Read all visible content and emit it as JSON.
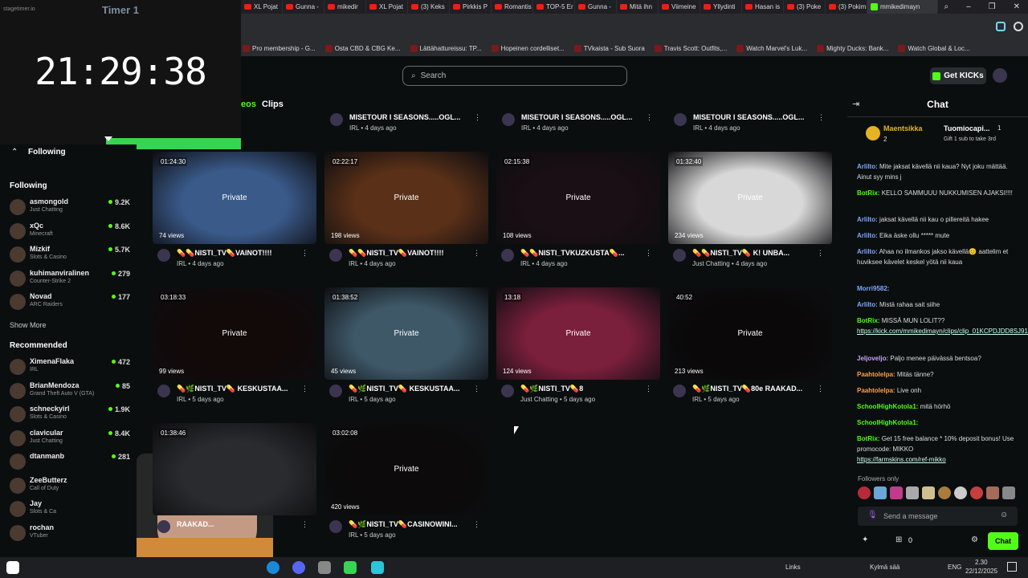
{
  "browser": {
    "tabs": [
      {
        "label": "XL Pojat",
        "icon": "youtube-icon"
      },
      {
        "label": "Gunna -",
        "icon": "youtube-icon"
      },
      {
        "label": "mikedir",
        "icon": "youtube-icon"
      },
      {
        "label": "XL Pojat",
        "icon": "youtube-icon"
      },
      {
        "label": "(3) Keks",
        "icon": "youtube-icon"
      },
      {
        "label": "Pirkkis P",
        "icon": "youtube-icon"
      },
      {
        "label": "Romantis",
        "icon": "youtube-icon"
      },
      {
        "label": "TOP-5 Er",
        "icon": "youtube-icon"
      },
      {
        "label": "Gunna -",
        "icon": "youtube-icon"
      },
      {
        "label": "Mitä ihn",
        "icon": "youtube-icon"
      },
      {
        "label": "Viimeine",
        "icon": "youtube-icon"
      },
      {
        "label": "Yllydinti",
        "icon": "youtube-icon"
      },
      {
        "label": "Hasan is",
        "icon": "youtube-icon"
      },
      {
        "label": "(3) Poke",
        "icon": "youtube-icon"
      },
      {
        "label": "(3) Pokim",
        "icon": "youtube-icon"
      },
      {
        "label": "mmikedimayn",
        "icon": "kick-icon"
      }
    ],
    "bookmarks": [
      "Pro membership - G...",
      "Osta CBD & CBG Ke...",
      "Lättähattureissu: TP...",
      "Hopeinen cordelliset...",
      "TVkaista - Sub Suora",
      "Travis Scott: Outfits,...",
      "Watch Marvel's Luk...",
      "Mighty Ducks: Bank...",
      "Watch Global & Loc..."
    ]
  },
  "timer": {
    "app": "stagetimer.io",
    "name": "Timer 1",
    "time": "21:29:38",
    "progress": 0.56
  },
  "header": {
    "search_placeholder": "Search",
    "get_kicks": "Get KICKs"
  },
  "tabs": {
    "videos": "eos",
    "clips": "Clips"
  },
  "sidebar": {
    "following_label": "Following",
    "following_section": "Following",
    "following": [
      {
        "name": "asmongold",
        "game": "Just Chatting",
        "viewers": "9.2K"
      },
      {
        "name": "xQc",
        "game": "Minecraft",
        "viewers": "8.6K"
      },
      {
        "name": "Mizkif",
        "game": "Slots & Casino",
        "viewers": "5.7K"
      },
      {
        "name": "kuhimanviralinen",
        "game": "Counter-Strike 2",
        "viewers": "279"
      },
      {
        "name": "Novad",
        "game": "ARC Raiders",
        "viewers": "177"
      }
    ],
    "show_more": "Show More",
    "recommended_section": "Recommended",
    "recommended": [
      {
        "name": "XimenaFlaka",
        "game": "IRL",
        "viewers": "472"
      },
      {
        "name": "BrianMendoza",
        "game": "Grand Theft Auto V (GTA)",
        "viewers": "85"
      },
      {
        "name": "schneckyirl",
        "game": "Slots & Casino",
        "viewers": "1.9K"
      },
      {
        "name": "clavicular",
        "game": "Just Chatting",
        "viewers": "8.4K"
      },
      {
        "name": "dtanmanb",
        "game": "",
        "viewers": "281"
      },
      {
        "name": "ZeeButterz",
        "game": "Call of Duty",
        "viewers": ""
      },
      {
        "name": "Jay",
        "game": "Slots & Ca",
        "viewers": ""
      },
      {
        "name": "rochan",
        "game": "VTuber",
        "viewers": ""
      }
    ]
  },
  "top_row": [
    {
      "title": "MISETOUR I SEASONS.....OGL...",
      "meta": "IRL • 4 days ago"
    },
    {
      "title": "MISETOUR I SEASONS.....OGL...",
      "meta": "IRL • 4 days ago"
    },
    {
      "title": "MISETOUR I SEASONS.....OGL...",
      "meta": "IRL • 4 days ago"
    }
  ],
  "videos": [
    {
      "duration": "01:24:30",
      "status": "Private",
      "views": "74 views",
      "title": "💊💊NISTI_TV💊VAINOT!!!!",
      "meta": "IRL • 4 days ago",
      "bg": "#3a5a8a"
    },
    {
      "duration": "02:22:17",
      "status": "Private",
      "views": "198 views",
      "title": "💊💊NISTI_TV💊VAINOT!!!!",
      "meta": "IRL • 4 days ago",
      "bg": "#5a3018"
    },
    {
      "duration": "02:15:38",
      "status": "Private",
      "views": "108 views",
      "title": "💊💊NISTI_TVKUZKUSTA💊...",
      "meta": "IRL • 4 days ago",
      "bg": "#1a0f14"
    },
    {
      "duration": "01:32:40",
      "status": "Private",
      "views": "234 views",
      "title": "💊💊NISTI_TV💊 K! UNBA...",
      "meta": "Just Chatting • 4 days ago",
      "bg": "#d8d8d8"
    },
    {
      "duration": "03:18:33",
      "status": "Private",
      "views": "99 views",
      "title": "💊🌿NISTI_TV💊 KESKUSTAA...",
      "meta": "IRL • 5 days ago",
      "bg": "#120909"
    },
    {
      "duration": "01:38:52",
      "status": "Private",
      "views": "45 views",
      "title": "💊🌿NISTI_TV💊 KESKUSTAA...",
      "meta": "IRL • 5 days ago",
      "bg": "#3e5868"
    },
    {
      "duration": "13:18",
      "status": "Private",
      "views": "124 views",
      "title": "💊🌿NISTI_TV💊8",
      "meta": "Just Chatting • 5 days ago",
      "bg": "#7a1f3c"
    },
    {
      "duration": "40:52",
      "status": "Private",
      "views": "213 views",
      "title": "💊🌿NISTI_TV💊80e RAAKAD...",
      "meta": "IRL • 5 days ago",
      "bg": "#0a0808"
    },
    {
      "duration": "01:38:46",
      "status": "",
      "views": "",
      "title": "RAAKAD...",
      "meta": "",
      "bg": "#2a2b2e"
    },
    {
      "duration": "03:02:08",
      "status": "Private",
      "views": "420 views",
      "title": "💊🌿NISTI_TV💊CASINOWINI...",
      "meta": "IRL • 5 days ago",
      "bg": "#0c0a0a"
    }
  ],
  "chat": {
    "title": "Chat",
    "pinned_user": "Maentsikka",
    "pinned_count": "2",
    "gift_user": "Tuomiocapi...",
    "gift_count": "1",
    "gift_text": "Gift 1 sub to take 3rd",
    "messages": [
      {
        "user": "Arlilto:",
        "text": "Mite jaksat kävellä nii kaua? Nyt joku mättää. Ainut syy mins j",
        "color": "#7fa8ff"
      },
      {
        "user": "BotRix:",
        "text": "KELLO SAMMUUU NUKKUMISEN AJAKSI!!!!",
        "color": "#53fc18"
      },
      {
        "user": "Arlilto:",
        "text": "jaksat kävellä nii kau o pillereitä hakee",
        "color": "#7fa8ff"
      },
      {
        "user": "Arlilto:",
        "text": "Eika äske ollu ***** mute",
        "color": "#7fa8ff"
      },
      {
        "user": "Arlilto:",
        "text": "Ahaa no ilmankos jakso kävellä😊 aattelim et huviksee kävelet keskel yötä nii kaua",
        "color": "#7fa8ff"
      },
      {
        "user": "Morri9582:",
        "text": "",
        "color": "#7fa8ff"
      },
      {
        "user": "Arlilto:",
        "text": "Mistä rahaa sait siihe",
        "color": "#7fa8ff"
      },
      {
        "user": "BotRix:",
        "text": "MISSÄ MUN LOLIT??",
        "color": "#53fc18"
      },
      {
        "user": "",
        "text": "https://kick.com/mmikedimayn/clips/clip_01KCPDJDD8SJ91EZF6VKDQYYBZ",
        "color": "#cfe"
      },
      {
        "user": "Jeljoveljo:",
        "text": "Paljo menee päivässä bentsoa?",
        "color": "#c9a0ff"
      },
      {
        "user": "Paahtolelpa:",
        "text": "Mitäs tänne?",
        "color": "#ff9f4a"
      },
      {
        "user": "Paahtolelpa:",
        "text": "Live onh",
        "color": "#ff9f4a"
      },
      {
        "user": "SchoolHighKotola1:",
        "text": "mitä hörhö",
        "color": "#53fc18"
      },
      {
        "user": "SchoolHighKotola1:",
        "text": "",
        "color": "#53fc18"
      },
      {
        "user": "BotRix:",
        "text": "Get 15 free balance * 10% deposit bonus! Use promocode: MIKKO",
        "color": "#53fc18"
      },
      {
        "user": "",
        "text": "https://farmskins.com/ref-mikko",
        "color": "#cfe"
      }
    ],
    "followers_only": "Followers only",
    "input_placeholder": "Send a message",
    "points": "0",
    "send_label": "Chat"
  },
  "taskbar": {
    "links": "Links",
    "weather": "Kylmä sää",
    "lang": "ENG",
    "time": "2.30",
    "date": "22/12/2025"
  }
}
